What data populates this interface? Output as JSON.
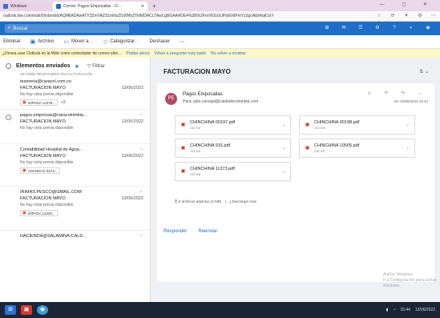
{
  "browser": {
    "tabs": [
      {
        "label": "Windows",
        "favicon_color": "#3b6fd0"
      },
      {
        "label": "Correo: Pagos Empocalias - O...",
        "favicon_color": "#1e6ec8"
      }
    ],
    "new_tab": "+",
    "window_controls": "— ◻ ✕",
    "url": "outlook.live.com/mail/0/inbox/id/AQMkADAwATY3ZmYAZS1mNzZiLWNhZTktMDACLTAwCgBGAAADE4%2B%2FmVEGUUlHyENIPmYz2gcA8zRqK1kY",
    "address_icons": [
      "☆",
      "⟳",
      "✦",
      "⚙",
      "⋯"
    ]
  },
  "outlook": {
    "search_placeholder": "Buscar",
    "top_icons": [
      "⊞",
      "✉",
      "☰",
      "⚙",
      "?",
      "◐",
      "◉"
    ],
    "commands": [
      {
        "icon": "🗑",
        "label": "Eliminar"
      },
      {
        "icon": "▣",
        "label": "Archivo"
      },
      {
        "icon": "▭",
        "label": "Mover a"
      },
      {
        "icon": "◇",
        "label": "Categorizar"
      },
      {
        "icon": "",
        "label": "Deshacer"
      },
      {
        "icon": "",
        "label": "⋯"
      }
    ],
    "banner": {
      "text": "¿Desea usar Outlook en la Web como controlador de correo elec...",
      "links": [
        "Probar ahora",
        "Volver a preguntar más tarde",
        "No volver a mostrar"
      ]
    }
  },
  "list": {
    "folder": "Elementos enviados",
    "filter": "Filtrar",
    "header_note": "SE DEBE RESPONDER EN FACTURACIÓN",
    "messages": [
      {
        "from": "tesoreria@caracol.com.co",
        "subject": "FACTURACIÓN MAYO",
        "date": "13/06/2022",
        "preview": "No hay vista previa disponible",
        "attachment": "20PADA 12378...",
        "more": "+3"
      },
      {
        "from": "pagos.empresas@caracolombia...",
        "subject": "FACTURACIÓN MAYO",
        "date": "13/06/2022",
        "preview": "No hay vista previa disponible",
        "attachment": "",
        "more": ""
      },
      {
        "from": "Contabilidad Hospital de Agua...",
        "subject": "FACTURACIÓN MAYO",
        "date": "13/06/2022",
        "preview": "No hay vista previa disponible",
        "attachment": "ANANDAS 0273...",
        "more": ""
      },
      {
        "from": "IRIMAS.PESCO@GMAIL.COM",
        "subject": "FACTURACIÓN MAYO",
        "date": "13/06/2022",
        "preview": "No hay vista previa disponible",
        "attachment": "20PADA 11326...",
        "more": ""
      },
      {
        "from": "HACIENDA@SALAMINA-CALD...",
        "subject": "",
        "date": "",
        "preview": "",
        "attachment": "",
        "more": ""
      }
    ]
  },
  "reading": {
    "subject": "FACTURACION MAYO",
    "header_icon": "⇅ ⌄",
    "sender": "Pagos Empocalias",
    "avatar_initials": "PE",
    "to": "Para: julio.carvajal@caldadecolombia.com",
    "actions": "☺ ↶ ↷ →",
    "date": "Vie 10/06/2022 15:44",
    "attachments": [
      {
        "name": "CHINCHINA 00197.pdf",
        "size": "245 KB"
      },
      {
        "name": "CHINCHINA 00198.pdf",
        "size": "245 KB"
      },
      {
        "name": "CHINCHINA 915.pdf",
        "size": "245 KB"
      },
      {
        "name": "CHINCHINA 10505.pdf",
        "size": "245 KB"
      },
      {
        "name": "CHINCHINA 11373.pdf",
        "size": "245 KB"
      }
    ],
    "download_summary": "5 archivos adjuntos (2 MB)",
    "download_all": "Descargar todo",
    "reply": "Responder",
    "forward": "Reenviar",
    "ghost_line1": "Activar Windows",
    "ghost_line2": "Ir a Configuración para activar Windows."
  },
  "taskbar": {
    "tray_time": "15:44",
    "tray_date": "13/06/2022"
  }
}
